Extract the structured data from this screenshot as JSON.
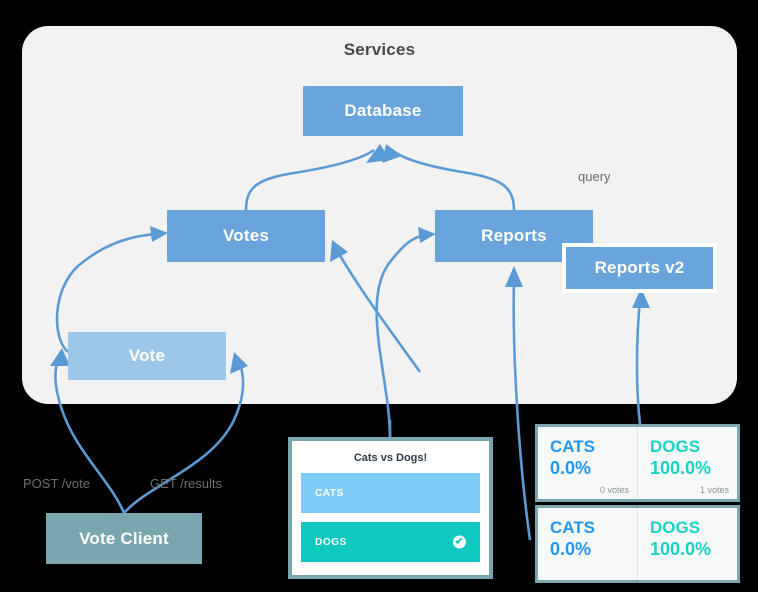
{
  "panel": {
    "title": "Services"
  },
  "nodes": {
    "database": "Database",
    "votes": "Votes",
    "reports": "Reports",
    "reports_v2": "Reports v2",
    "vote": "Vote",
    "vote_client": "Vote Client"
  },
  "edge_labels": {
    "query": "query",
    "post_vote": "POST /vote",
    "get_results": "GET /results"
  },
  "vote_widget": {
    "title": "Cats vs Dogs!",
    "options": [
      {
        "label": "CATS",
        "selected": false,
        "color": "#7fcdf7"
      },
      {
        "label": "DOGS",
        "selected": true,
        "color": "#0fc8c0",
        "check": "✔"
      }
    ]
  },
  "results": [
    {
      "cats": {
        "label": "CATS",
        "percent": "0.0%",
        "votes": "0 votes",
        "color": "#2196f3"
      },
      "dogs": {
        "label": "DOGS",
        "percent": "100.0%",
        "votes": "1 votes",
        "color": "#19d3c5"
      }
    },
    {
      "cats": {
        "label": "CATS",
        "percent": "0.0%",
        "votes": "",
        "color": "#2196f3"
      },
      "dogs": {
        "label": "DOGS",
        "percent": "100.0%",
        "votes": "",
        "color": "#19d3c5"
      }
    }
  ],
  "colors": {
    "panel_bg": "#f2f2f2",
    "node_blue": "#69a5dc",
    "node_light_blue": "#9cc7e8",
    "client_teal": "#7aa6b0",
    "arrow_blue": "#5b9bd5",
    "background": "#000000"
  }
}
